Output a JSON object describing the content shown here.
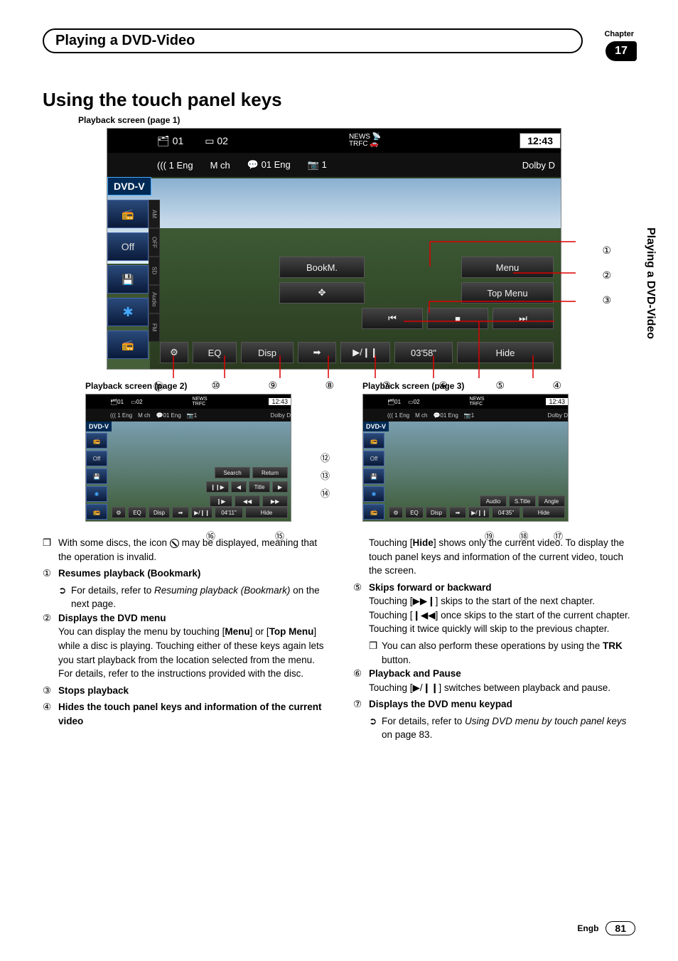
{
  "chapter": {
    "label": "Chapter",
    "number": "17"
  },
  "title_bar": "Playing a DVD-Video",
  "side_tab": "Playing a DVD-Video",
  "section_heading": "Using the touch panel keys",
  "captions": {
    "s1": "Playback screen (page 1)",
    "s2": "Playback screen (page 2)",
    "s3": "Playback screen (page 3)"
  },
  "screen1": {
    "top": {
      "title": "01",
      "chapter": "02",
      "news": "NEWS",
      "trfc": "TRFC",
      "clock": "12:43"
    },
    "sub": {
      "audio": "((( 1  Eng",
      "mch": "M ch",
      "subtitle": "01  Eng",
      "angle": "1",
      "dolby": "Dolby D"
    },
    "dvd": "DVD-V",
    "side_tabs": [
      "AM",
      "OFF",
      "SD",
      "Audio",
      "FM"
    ],
    "left_tabs": [
      "",
      "Off",
      "",
      "✱",
      ""
    ],
    "buttons": {
      "bookm": "BookM.",
      "menu": "Menu",
      "arrows": "✥",
      "topmenu": "Top Menu",
      "prev": "⏮",
      "stop": "■",
      "next": "⏭",
      "gear": "⚙",
      "eq": "EQ",
      "disp": "Disp",
      "page": "➡",
      "play": "▶/❙❙",
      "time": "03'58\"",
      "hide": "Hide"
    }
  },
  "screen2": {
    "time": "04'11\"",
    "buttons": {
      "search": "Search",
      "return": "Return",
      "slow": "❙❙▶",
      "titleprev": "◀",
      "title": "Title",
      "titlenext": "▶",
      "frame": "❙▶",
      "rev": "◀◀",
      "fwd": "▶▶",
      "hide": "Hide",
      "eq": "EQ",
      "disp": "Disp"
    }
  },
  "screen3": {
    "time": "04'35\"",
    "buttons": {
      "audio": "Audio",
      "stitle": "S.Title",
      "angle": "Angle",
      "hide": "Hide",
      "eq": "EQ",
      "disp": "Disp"
    }
  },
  "callouts": {
    "bottom": [
      "⑪",
      "⑩",
      "⑨",
      "⑧",
      "⑦",
      "⑥",
      "⑤",
      "④"
    ],
    "right": [
      "①",
      "②",
      "③"
    ],
    "s2_right": [
      "⑫",
      "⑬",
      "⑭"
    ],
    "s2_bottom": [
      "⑯",
      "⑮"
    ],
    "s3_bottom": [
      "⑲",
      "⑱",
      "⑰"
    ]
  },
  "body": {
    "note_box": "❐",
    "note_text_a": "With some discs, the icon ",
    "note_text_b": " may be displayed, meaning that the operation is invalid.",
    "items": [
      {
        "n": "①",
        "bold": "Resumes playback (Bookmark)",
        "sub_arrow": "➲",
        "sub": "For details, refer to ",
        "sub_i": "Resuming playback (Bookmark)",
        "sub2": " on the next page."
      },
      {
        "n": "②",
        "bold": "Displays the DVD menu",
        "text": "You can display the menu by touching [",
        "b1": "Menu",
        "text2": "] or [",
        "b2": "Top Menu",
        "text3": "] while a disc is playing. Touching either of these keys again lets you start playback from the location selected from the menu. For details, refer to the instructions provided with the disc."
      },
      {
        "n": "③",
        "bold": "Stops playback"
      },
      {
        "n": "④",
        "bold": "Hides the touch panel keys and information of the current video"
      }
    ],
    "col2_intro_a": "Touching [",
    "col2_intro_b": "Hide",
    "col2_intro_c": "] shows only the current video. To display the touch panel keys and information of the current video, touch the screen.",
    "items2": [
      {
        "n": "⑤",
        "bold": "Skips forward or backward",
        "text_a": "Touching [",
        "sym1": "▶▶❙",
        "text_b": "] skips to the start of the next chapter. Touching [",
        "sym2": "❙◀◀",
        "text_c": "] once skips to the start of the current chapter. Touching it twice quickly will skip to the previous chapter.",
        "sub_box": "❐",
        "sub": "You can also perform these operations by using the ",
        "sub_b": "TRK",
        "sub2": " button."
      },
      {
        "n": "⑥",
        "bold": "Playback and Pause",
        "text_a": "Touching [",
        "sym1": "▶/❙❙",
        "text_b": "] switches between playback and pause."
      },
      {
        "n": "⑦",
        "bold": "Displays the DVD menu keypad",
        "sub_arrow": "➲",
        "sub": "For details, refer to ",
        "sub_i": "Using DVD menu by touch panel keys",
        "sub2": " on page 83."
      }
    ]
  },
  "footer": {
    "lang": "Engb",
    "page": "81"
  }
}
